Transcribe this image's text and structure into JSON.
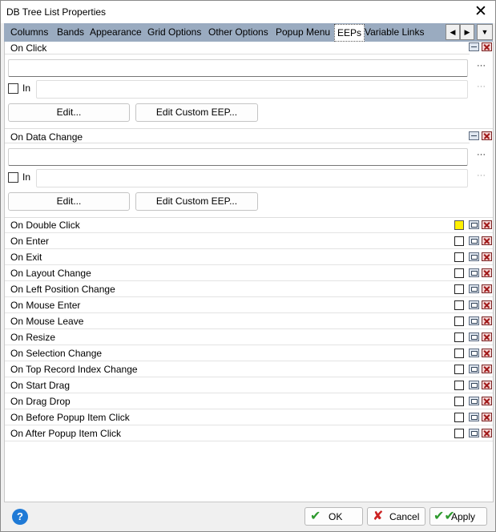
{
  "window": {
    "title": "DB Tree List Properties"
  },
  "tabs": [
    "Columns",
    "Bands",
    "Appearance",
    "Grid Options",
    "Other Options",
    "Popup Menu",
    "EEPs",
    "Variable Links"
  ],
  "tab_nav": {
    "left": "◀",
    "right": "▶",
    "menu": "▼"
  },
  "ellipsis": "···",
  "on_click": {
    "title": "On Click",
    "value": "",
    "in_label": "In",
    "in_value": "",
    "edit_label": "Edit...",
    "custom_label": "Edit Custom EEP..."
  },
  "on_data_change": {
    "title": "On Data Change",
    "value": "",
    "in_label": "In",
    "in_value": "",
    "edit_label": "Edit...",
    "custom_label": "Edit Custom EEP..."
  },
  "events": [
    "On Double Click",
    "On Enter",
    "On Exit",
    "On Layout Change",
    "On Left Position Change",
    "On Mouse Enter",
    "On Mouse Leave",
    "On Resize",
    "On Selection Change",
    "On Top Record Index Change",
    "On Start Drag",
    "On Drag Drop",
    "On Before Popup Item Click",
    "On After Popup Item Click"
  ],
  "buttons": {
    "help": "?",
    "ok": "OK",
    "cancel": "Cancel",
    "apply": "Apply"
  },
  "colors": {
    "tab_strip": "#9aabc0",
    "highlight_check": "#fff000",
    "help_icon": "#1f7ad6"
  }
}
